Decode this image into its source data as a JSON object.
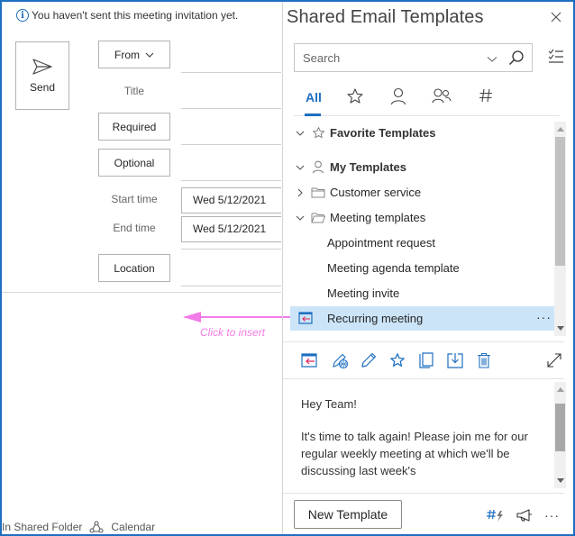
{
  "meeting": {
    "info_message": "You haven't sent this meeting invitation yet.",
    "send_label": "Send",
    "from_label": "From",
    "title_label": "Title",
    "required_label": "Required",
    "optional_label": "Optional",
    "start_time_label": "Start time",
    "start_date": "Wed 5/12/2021",
    "end_time_label": "End time",
    "end_date": "Wed 5/12/2021",
    "location_label": "Location",
    "annotation": "Click to insert",
    "status": {
      "folder": "In Shared Folder",
      "calendar": "Calendar"
    }
  },
  "pane": {
    "title": "Shared Email Templates",
    "search_placeholder": "Search",
    "tabs": [
      {
        "label": "All",
        "active": true
      },
      {
        "label": "Favorites",
        "icon": "star-icon"
      },
      {
        "label": "My Templates",
        "icon": "person-icon"
      },
      {
        "label": "Team Templates",
        "icon": "people-icon"
      },
      {
        "label": "Macros",
        "icon": "hash-icon"
      }
    ],
    "tree": [
      {
        "label": "Favorite Templates",
        "level": 0,
        "bold": true,
        "expanded": true,
        "icon": "star-icon"
      },
      {
        "label": "My Templates",
        "level": 0,
        "bold": true,
        "expanded": true,
        "icon": "person-icon"
      },
      {
        "label": "Customer service",
        "level": 1,
        "expanded": false,
        "icon": "folder-icon"
      },
      {
        "label": "Meeting templates",
        "level": 1,
        "expanded": true,
        "icon": "folder-open-icon"
      },
      {
        "label": "Appointment request",
        "level": 2
      },
      {
        "label": "Meeting agenda template",
        "level": 2
      },
      {
        "label": "Meeting invite",
        "level": 2
      },
      {
        "label": "Recurring meeting",
        "level": 2,
        "selected": true
      }
    ],
    "preview": [
      "Hey Team!",
      "It's time to talk again! Please join me for our regular weekly meeting at which we'll be discussing last week's"
    ],
    "new_template_label": "New Template"
  },
  "colors": {
    "accent": "#1e6fc0",
    "selection": "#cce4f7",
    "annotation": "#f27ce8"
  }
}
